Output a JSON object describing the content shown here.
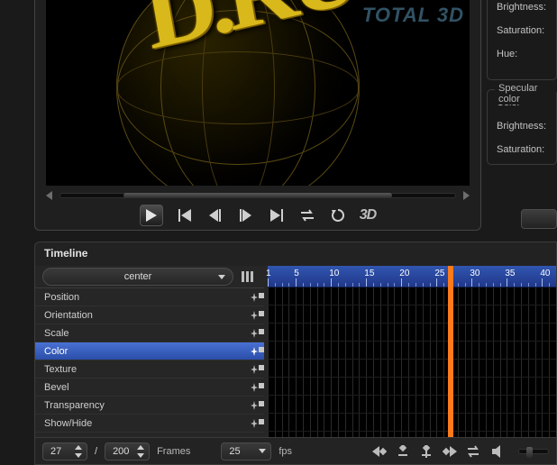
{
  "watermark": "TOTAL 3D",
  "viewport_logo_text": "D.RU",
  "playback_3d_label": "3D",
  "inspector": {
    "group1": {
      "rows": [
        "Brightness:",
        "Saturation:",
        "Hue:"
      ]
    },
    "group2": {
      "title": "Specular color",
      "rows": [
        "Color",
        "Brightness:",
        "Saturation:"
      ]
    }
  },
  "timeline": {
    "title": "Timeline",
    "object_selector": "center",
    "tracks": [
      "Position",
      "Orientation",
      "Scale",
      "Color",
      "Texture",
      "Bevel",
      "Transparency",
      "Show/Hide"
    ],
    "selected_track_index": 3,
    "ruler": {
      "start": 1,
      "end": 42,
      "major_step": 5,
      "playhead": 27
    },
    "keyframes": {
      "3": [
        27
      ]
    }
  },
  "footer": {
    "current_frame": "27",
    "total_frames": "200",
    "frames_label": "Frames",
    "fps_value": "25",
    "fps_label": "fps"
  }
}
